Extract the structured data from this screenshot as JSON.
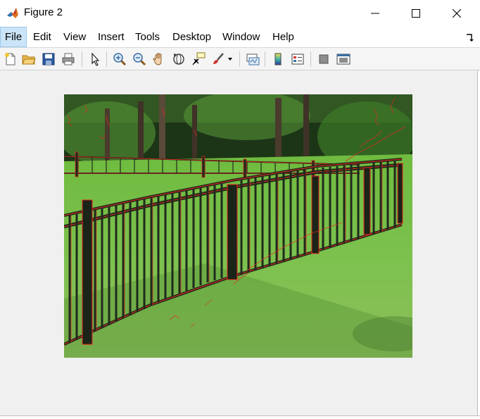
{
  "window": {
    "title": "Figure 2",
    "controls": {
      "minimize_icon": "minimize-icon",
      "maximize_icon": "maximize-icon",
      "close_icon": "close-icon"
    }
  },
  "menu": {
    "items": [
      "File",
      "Edit",
      "View",
      "Insert",
      "Tools",
      "Desktop",
      "Window",
      "Help"
    ],
    "active": "File"
  },
  "toolbar": {
    "buttons": [
      "new-figure-icon",
      "open-file-icon",
      "save-icon",
      "print-icon",
      "select-arrow-icon",
      "zoom-in-icon",
      "zoom-out-icon",
      "pan-hand-icon",
      "rotate-3d-icon",
      "data-cursor-icon",
      "brush-icon",
      "link-plot-icon",
      "colorbar-icon",
      "legend-icon",
      "hide-plot-tools-icon",
      "show-plot-tools-icon"
    ]
  },
  "figure": {
    "content": "photo of a black metal fence on a green lawn with red edge-detection overlay"
  },
  "colors": {
    "figure_background": "#f0f0f0",
    "menu_highlight": "#cce4f7",
    "edge_overlay": "#e8281e",
    "fence": "#1f2a1c",
    "grass": "#6fb84a",
    "trees": "#1f3a1a"
  }
}
